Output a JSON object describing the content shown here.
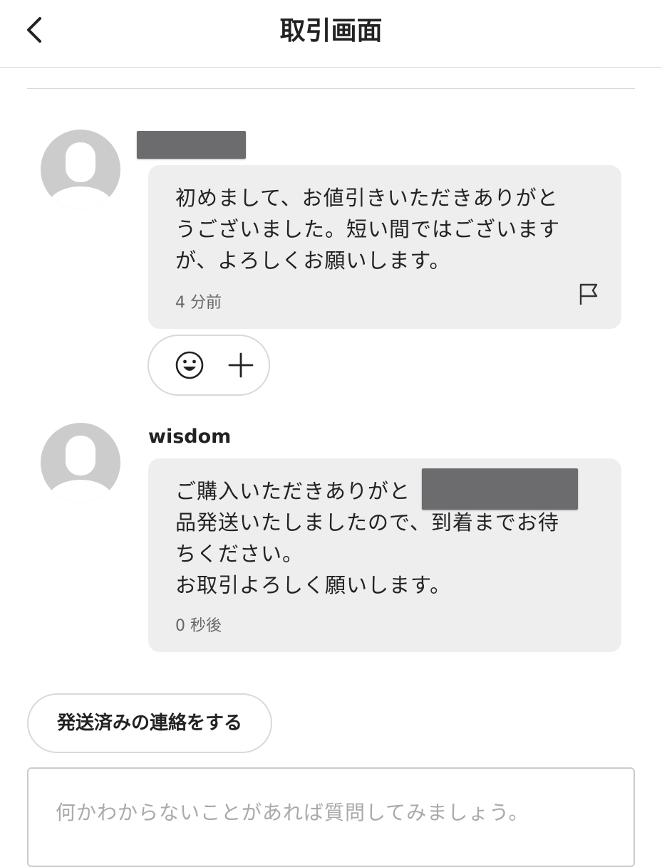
{
  "header": {
    "title": "取引画面",
    "back_icon": "chevron-left-icon"
  },
  "messages": [
    {
      "sender": "",
      "sender_redacted": true,
      "lines": [
        "初めまして、お値引きいただきありがと",
        "うございました。短い間ではございます",
        "が、よろしくお願いします。"
      ],
      "time": "4 分前",
      "report_icon": "flag-icon"
    },
    {
      "sender": "wisdom",
      "lines": [
        "ご購入いただきありがと",
        "品発送いたしましたので、到着までお待",
        "ちください。",
        "お取引よろしく願いします。"
      ],
      "time": "0 秒後"
    }
  ],
  "reactions": {
    "emoji_icon": "smiley-icon",
    "add_icon": "plus-icon"
  },
  "actions": {
    "shipped_label": "発送済みの連絡をする"
  },
  "composer": {
    "placeholder": "何かわからないことがあれば質問してみましょう。"
  },
  "colors": {
    "bubble_bg": "#eeeeee",
    "avatar_bg": "#cccccc",
    "redaction": "#6c6c6e"
  }
}
